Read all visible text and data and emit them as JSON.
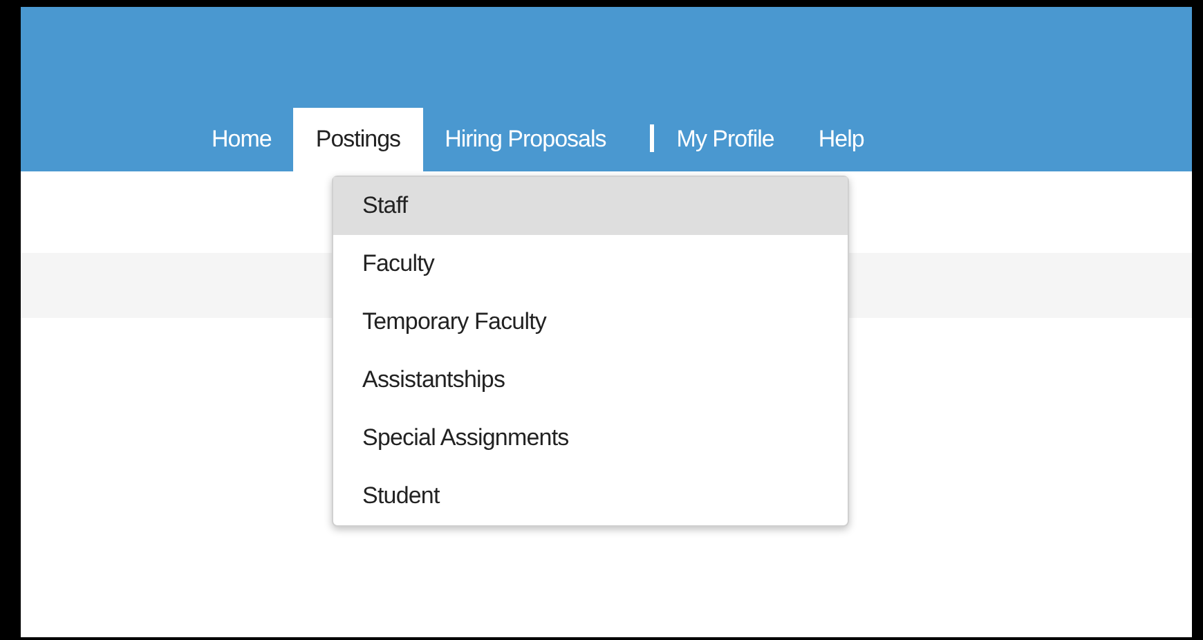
{
  "nav": {
    "items": [
      {
        "label": "Home",
        "selected": false,
        "divider_before": false
      },
      {
        "label": "Postings",
        "selected": true,
        "divider_before": false
      },
      {
        "label": "Hiring Proposals",
        "selected": false,
        "divider_before": false
      },
      {
        "label": "My Profile",
        "selected": false,
        "divider_before": true
      },
      {
        "label": "Help",
        "selected": false,
        "divider_before": false
      }
    ]
  },
  "dropdown": {
    "items": [
      {
        "label": "Staff",
        "selected": true
      },
      {
        "label": "Faculty",
        "selected": false
      },
      {
        "label": "Temporary Faculty",
        "selected": false
      },
      {
        "label": "Assistantships",
        "selected": false
      },
      {
        "label": "Special Assignments",
        "selected": false
      },
      {
        "label": "Student",
        "selected": false
      }
    ]
  }
}
